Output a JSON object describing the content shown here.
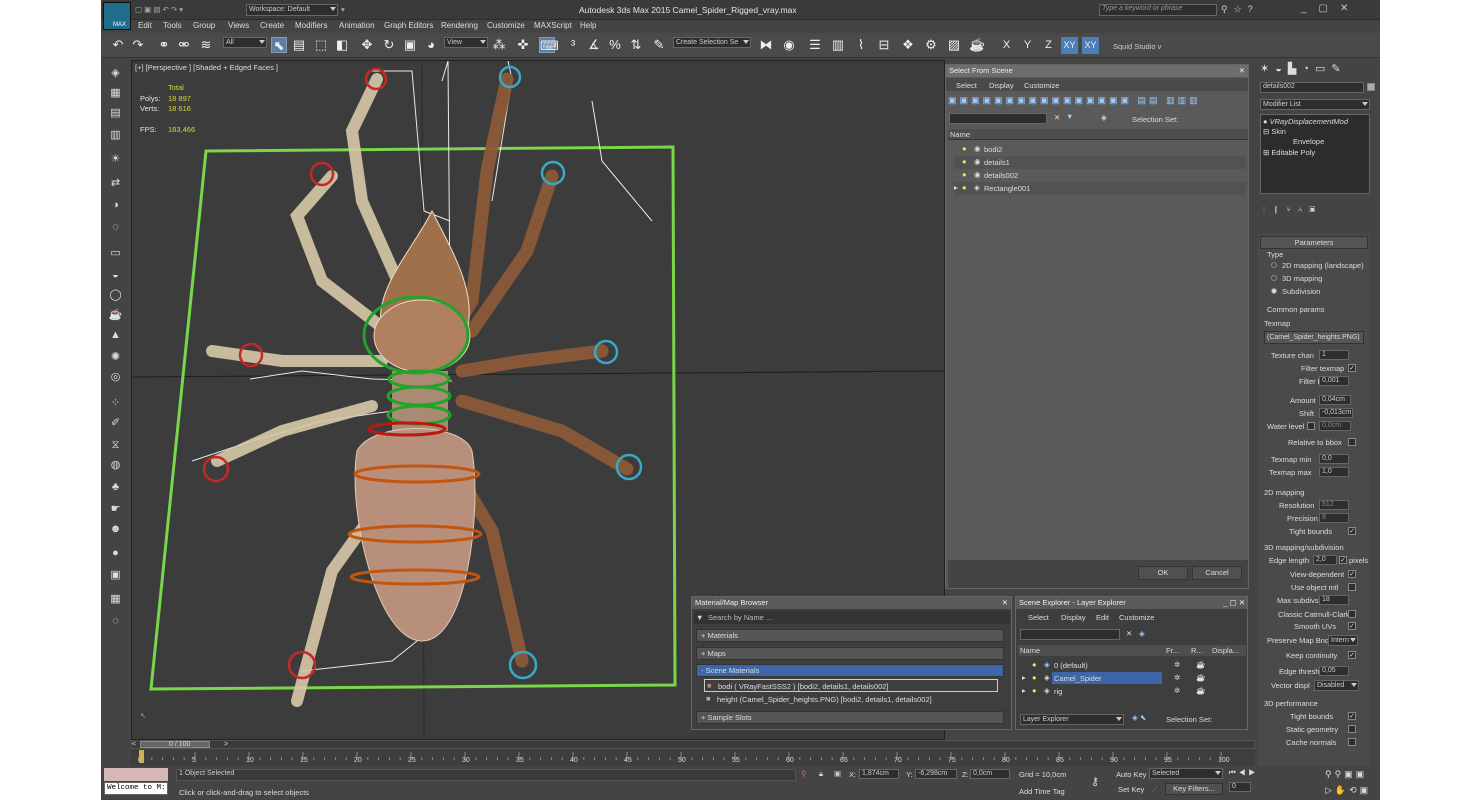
{
  "app": {
    "title": "Autodesk 3ds Max  2015    Camel_Spider_Rigged_vray.max",
    "logo_text": "MAX",
    "workspace": "Workspace: Default",
    "search_placeholder": "Type a keyword or phrase"
  },
  "menu": [
    "Edit",
    "Tools",
    "Group",
    "Views",
    "Create",
    "Modifiers",
    "Animation",
    "Graph Editors",
    "Rendering",
    "Customize",
    "MAXScript",
    "Help"
  ],
  "toolbar": {
    "filter": "All",
    "refcoord": "View",
    "selection_set": "Create Selection Se",
    "axis": [
      "X",
      "Y",
      "Z",
      "XY",
      "XY"
    ],
    "workspace_label": "Squid Studio v"
  },
  "viewport": {
    "label": "[+] [Perspective ] [Shaded + Edged Faces ]",
    "stats": {
      "total": "Total",
      "polys_label": "Polys:",
      "polys": "18 897",
      "verts_label": "Verts:",
      "verts": "18 616",
      "fps_label": "FPS:",
      "fps": "183,466"
    }
  },
  "select_from_scene": {
    "title": "Select From Scene",
    "tabs": [
      "Select",
      "Display",
      "Customize"
    ],
    "selection_set_label": "Selection Set:",
    "column": "Name",
    "items": [
      "bodi2",
      "details1",
      "details002",
      "Rectangle001"
    ],
    "ok": "OK",
    "cancel": "Cancel"
  },
  "material_browser": {
    "title": "Material/Map Browser",
    "search": "Search by Name ...",
    "groups": [
      "+ Materials",
      "+ Maps",
      "- Scene Materials",
      "+ Sample Slots"
    ],
    "items": [
      "bodi  ( VRayFastSSS2 ) [bodi2, details1, details002]",
      "height (Camel_Spider_heights.PNG) [bodi2, details1, details002]"
    ]
  },
  "scene_explorer": {
    "title": "Scene Explorer - Layer Explorer",
    "tabs": [
      "Select",
      "Display",
      "Edit",
      "Customize"
    ],
    "columns": [
      "Name",
      "Fr...",
      "R...",
      "Displa..."
    ],
    "layers": [
      "0 (default)",
      "Camel_Spider",
      "rig"
    ],
    "footer_combo": "Layer Explorer",
    "selection_set": "Selection Set:"
  },
  "command_panel": {
    "object_name": "details002",
    "modifier_list": "Modifier List",
    "stack": [
      "VRayDisplacementMod",
      "Skin",
      "Envelope",
      "Editable Poly"
    ],
    "parameters": {
      "header": "Parameters",
      "type_label": "Type",
      "types": [
        "2D mapping (landscape)",
        "3D mapping",
        "Subdivision"
      ],
      "common": "Common params",
      "texmap": "Texmap",
      "texmap_value": "(Camel_Spider_heights.PNG)",
      "texture_chan": "Texture chan",
      "texture_chan_v": "1",
      "filter_texmap": "Filter texmap",
      "filter_blur": "Filter blur",
      "filter_blur_v": "0,001",
      "amount": "Amount",
      "amount_v": "0,04cm",
      "shift": "Shift",
      "shift_v": "-0,013cm",
      "water": "Water level",
      "water_v": "0,0cm",
      "relative": "Relative to bbox",
      "tmin": "Texmap min",
      "tmin_v": "0,0",
      "tmax": "Texmap max",
      "tmax_v": "1,0",
      "m2d": "2D mapping",
      "resolution": "Resolution",
      "resolution_v": "512",
      "precision": "Precision",
      "precision_v": "8",
      "tight": "Tight bounds",
      "m3d": "3D mapping/subdivision",
      "edge": "Edge length",
      "edge_v": "2,0",
      "pixels": "pixels",
      "viewdep": "View-dependent",
      "useobj": "Use object mtl",
      "maxsub": "Max subdivs",
      "maxsub_v": "18",
      "catmull": "Classic Catmull-Clark",
      "smooth": "Smooth UVs",
      "preserve": "Preserve Map Bnd",
      "preserve_v": "Intern",
      "keep": "Keep continuity",
      "thresh": "Edge thresh",
      "thresh_v": "0,05",
      "vecdisp": "Vector displ",
      "vecdisp_v": "Disabled",
      "perf": "3D performance",
      "tight2": "Tight bounds",
      "static": "Static geometry",
      "cache": "Cache normals"
    }
  },
  "timeline": {
    "frame": "0 / 100",
    "ticks": [
      "0",
      "5",
      "10",
      "15",
      "20",
      "25",
      "30",
      "35",
      "40",
      "45",
      "50",
      "55",
      "60",
      "65",
      "70",
      "75",
      "80",
      "85",
      "90",
      "95",
      "100"
    ]
  },
  "status": {
    "selected": "1 Object Selected",
    "prompt": "Click or click-and-drag to select objects",
    "welcome": "Welcome to M:",
    "x_label": "X:",
    "x": "1,874cm",
    "y_label": "Y:",
    "y": "-6,298cm",
    "z_label": "Z:",
    "z": "0,0cm",
    "grid": "Grid = 10,0cm",
    "addtime": "Add Time Tag",
    "autokey": "Auto Key",
    "setkey": "Set Key",
    "selected_combo": "Selected",
    "keyfilters": "Key Filters...",
    "frame_v": "0"
  }
}
